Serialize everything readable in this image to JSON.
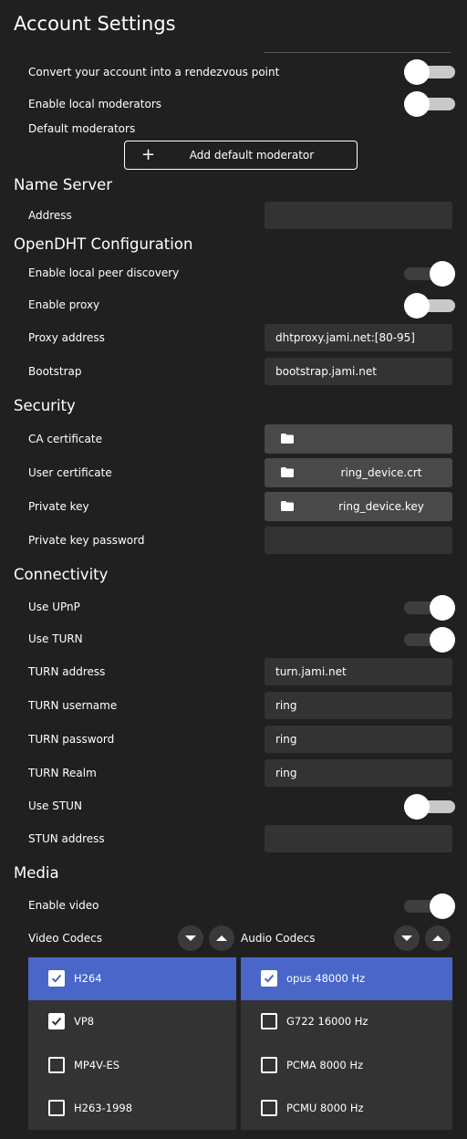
{
  "header": {
    "title": "Account Settings"
  },
  "rendezvous": {
    "convert_label": "Convert your account into a rendezvous point",
    "convert_on": false,
    "local_mods_label": "Enable local moderators",
    "local_mods_on": false,
    "default_mods_label": "Default moderators",
    "add_mod_button": "Add default moderator"
  },
  "name_server": {
    "heading": "Name Server",
    "address_label": "Address",
    "address_value": ""
  },
  "opendht": {
    "heading": "OpenDHT Configuration",
    "peer_discovery_label": "Enable local peer discovery",
    "peer_discovery_on": true,
    "proxy_label": "Enable proxy",
    "proxy_on": false,
    "proxy_address_label": "Proxy address",
    "proxy_address_value": "dhtproxy.jami.net:[80-95]",
    "bootstrap_label": "Bootstrap",
    "bootstrap_value": "bootstrap.jami.net"
  },
  "security": {
    "heading": "Security",
    "ca_label": "CA certificate",
    "ca_file": "",
    "user_cert_label": "User certificate",
    "user_cert_file": "ring_device.crt",
    "private_key_label": "Private key",
    "private_key_file": "ring_device.key",
    "private_key_password_label": "Private key password",
    "private_key_password_value": ""
  },
  "connectivity": {
    "heading": "Connectivity",
    "upnp_label": "Use UPnP",
    "upnp_on": true,
    "turn_label": "Use TURN",
    "turn_on": true,
    "turn_address_label": "TURN address",
    "turn_address_value": "turn.jami.net",
    "turn_username_label": "TURN username",
    "turn_username_value": "ring",
    "turn_password_label": "TURN password",
    "turn_password_value": "ring",
    "turn_realm_label": "TURN Realm",
    "turn_realm_value": "ring",
    "stun_label": "Use STUN",
    "stun_on": false,
    "stun_address_label": "STUN address",
    "stun_address_value": ""
  },
  "media": {
    "heading": "Media",
    "enable_video_label": "Enable video",
    "enable_video_on": true,
    "video_codecs_label": "Video Codecs",
    "audio_codecs_label": "Audio Codecs",
    "video_codecs": [
      {
        "name": "H264",
        "checked": true,
        "selected": true
      },
      {
        "name": "VP8",
        "checked": true,
        "selected": false
      },
      {
        "name": "MP4V-ES",
        "checked": false,
        "selected": false
      },
      {
        "name": "H263-1998",
        "checked": false,
        "selected": false
      }
    ],
    "audio_codecs": [
      {
        "name": "opus 48000 Hz",
        "checked": true,
        "selected": true
      },
      {
        "name": "G722 16000 Hz",
        "checked": false,
        "selected": false
      },
      {
        "name": "PCMA 8000 Hz",
        "checked": false,
        "selected": false
      },
      {
        "name": "PCMU 8000 Hz",
        "checked": false,
        "selected": false
      }
    ]
  },
  "colors": {
    "background": "#202020",
    "field": "#333333",
    "file_button": "#494949",
    "selection": "#4a66c9",
    "toggle_off_track": "#c9c9c9",
    "toggle_on_track": "#3e3e3e"
  },
  "icons": {
    "folder": "folder-icon",
    "plus": "plus-icon",
    "arrow_down": "arrow-down-icon",
    "arrow_up": "arrow-up-icon",
    "check": "check-icon"
  }
}
